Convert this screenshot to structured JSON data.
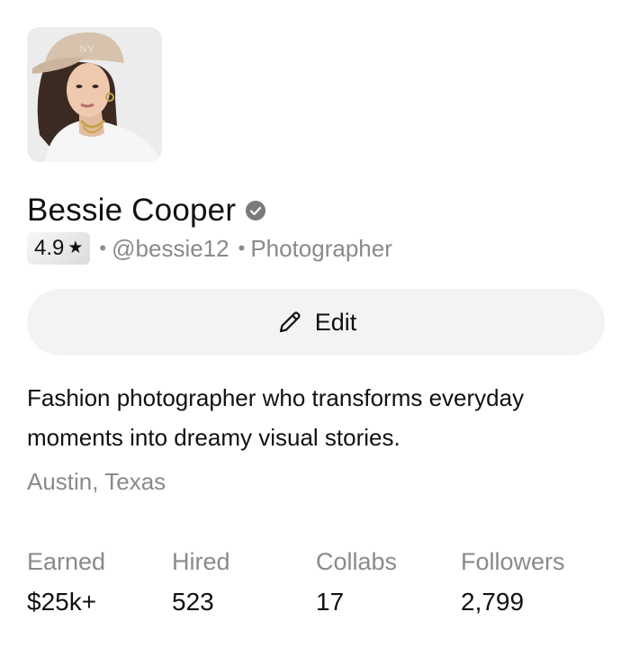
{
  "profile": {
    "name": "Bessie Cooper",
    "verified_icon": "verified-check-icon",
    "rating": "4.9",
    "rating_icon": "star-icon",
    "handle": "@bessie12",
    "role": "Photographer",
    "separator": "•",
    "bio": "Fashion photographer who transforms everyday moments into dreamy visual stories.",
    "location": "Austin, Texas"
  },
  "actions": {
    "edit_label": "Edit",
    "edit_icon": "pencil-icon"
  },
  "stats": [
    {
      "label": "Earned",
      "value": "$25k+"
    },
    {
      "label": "Hired",
      "value": "523"
    },
    {
      "label": "Collabs",
      "value": "17"
    },
    {
      "label": "Followers",
      "value": "2,799"
    }
  ],
  "colors": {
    "text_primary": "#111111",
    "text_secondary": "#8a8a8a",
    "button_bg": "#f3f3f4",
    "verified_badge": "#7a7a7a"
  }
}
